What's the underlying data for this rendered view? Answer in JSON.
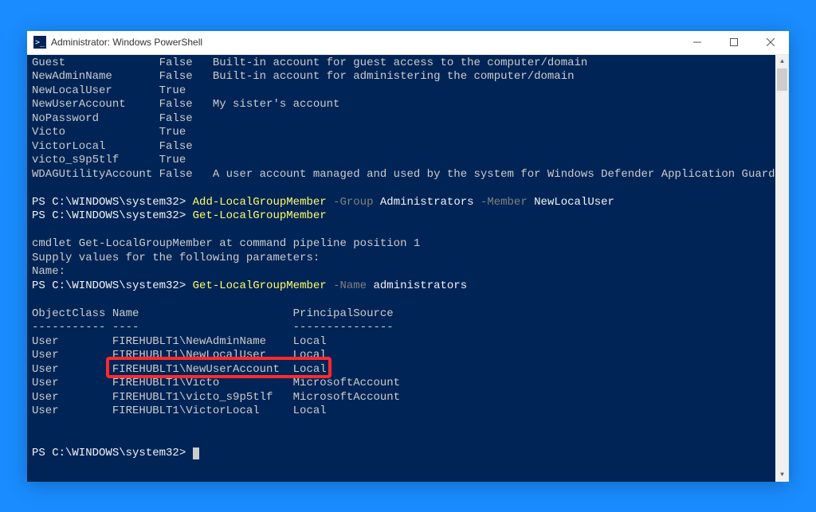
{
  "window": {
    "title": "Administrator: Windows PowerShell",
    "icon_glyph": ">_"
  },
  "colors": {
    "console_bg": "#012456",
    "text": "#cccccc",
    "cmdlet": "#ffff66",
    "param": "#808080",
    "desktop": "#1a8cff"
  },
  "accounts": [
    {
      "name": "Guest",
      "enabled": "False",
      "desc": "Built-in account for guest access to the computer/domain"
    },
    {
      "name": "NewAdminName",
      "enabled": "False",
      "desc": "Built-in account for administering the computer/domain"
    },
    {
      "name": "NewLocalUser",
      "enabled": "True",
      "desc": ""
    },
    {
      "name": "NewUserAccount",
      "enabled": "False",
      "desc": "My sister's account"
    },
    {
      "name": "NoPassword",
      "enabled": "False",
      "desc": ""
    },
    {
      "name": "Victo",
      "enabled": "True",
      "desc": ""
    },
    {
      "name": "VictorLocal",
      "enabled": "False",
      "desc": ""
    },
    {
      "name": "victo_s9p5tlf",
      "enabled": "True",
      "desc": ""
    },
    {
      "name": "WDAGUtilityAccount",
      "enabled": "False",
      "desc": "A user account managed and used by the system for Windows Defender Application Guard scen..."
    }
  ],
  "prompt": "PS C:\\WINDOWS\\system32>",
  "cmd1": {
    "cmdlet": "Add-LocalGroupMember",
    "p1": "-Group",
    "v1": "Administrators",
    "p2": "-Member",
    "v2": "NewLocalUser"
  },
  "cmd2": {
    "cmdlet": "Get-LocalGroupMember"
  },
  "pipeline_msg1": "cmdlet Get-LocalGroupMember at command pipeline position 1",
  "pipeline_msg2": "Supply values for the following parameters:",
  "pipeline_msg3": "Name:",
  "cmd3": {
    "cmdlet": "Get-LocalGroupMember",
    "p1": "-Name",
    "v1": "administrators"
  },
  "table": {
    "h1": "ObjectClass",
    "h2": "Name",
    "h3": "PrincipalSource",
    "u1": "-----------",
    "u2": "----",
    "u3": "---------------",
    "rows": [
      {
        "oc": "User",
        "name": "FIREHUBLT1\\NewAdminName",
        "src": "Local"
      },
      {
        "oc": "User",
        "name": "FIREHUBLT1\\NewLocalUser",
        "src": "Local"
      },
      {
        "oc": "User",
        "name": "FIREHUBLT1\\NewUserAccount",
        "src": "Local"
      },
      {
        "oc": "User",
        "name": "FIREHUBLT1\\Victo",
        "src": "MicrosoftAccount"
      },
      {
        "oc": "User",
        "name": "FIREHUBLT1\\victo_s9p5tlf",
        "src": "MicrosoftAccount"
      },
      {
        "oc": "User",
        "name": "FIREHUBLT1\\VictorLocal",
        "src": "Local"
      }
    ]
  },
  "highlight_row_index": 2
}
